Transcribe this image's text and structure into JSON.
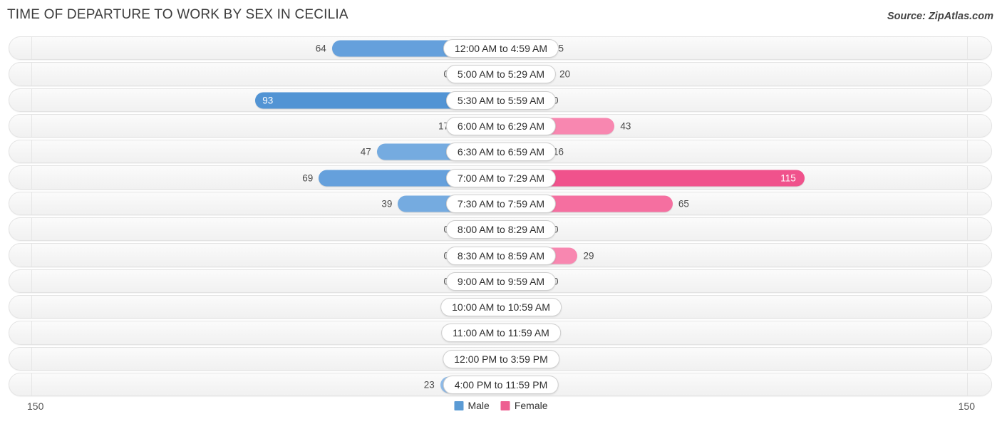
{
  "header": {
    "title": "TIME OF DEPARTURE TO WORK BY SEX IN CECILIA",
    "source": "Source: ZipAtlas.com"
  },
  "legend": {
    "male_label": "Male",
    "female_label": "Female",
    "male_color": "#5b9bd5",
    "female_color": "#ed5f91"
  },
  "axis": {
    "left_max": "150",
    "right_max": "150"
  },
  "chart_data": {
    "type": "bar",
    "title": "TIME OF DEPARTURE TO WORK BY SEX IN CECILIA",
    "orientation": "horizontal-diverging",
    "xlabel": "",
    "ylabel": "",
    "xlim": [
      150,
      150
    ],
    "grid": false,
    "legend_position": "bottom-center",
    "categories": [
      "12:00 AM to 4:59 AM",
      "5:00 AM to 5:29 AM",
      "5:30 AM to 5:59 AM",
      "6:00 AM to 6:29 AM",
      "6:30 AM to 6:59 AM",
      "7:00 AM to 7:29 AM",
      "7:30 AM to 7:59 AM",
      "8:00 AM to 8:29 AM",
      "8:30 AM to 8:59 AM",
      "9:00 AM to 9:59 AM",
      "10:00 AM to 10:59 AM",
      "11:00 AM to 11:59 AM",
      "12:00 PM to 3:59 PM",
      "4:00 PM to 11:59 PM"
    ],
    "series": [
      {
        "name": "Male",
        "values": [
          64,
          0,
          93,
          17,
          47,
          69,
          39,
          0,
          0,
          0,
          0,
          0,
          0,
          23
        ]
      },
      {
        "name": "Female",
        "values": [
          15,
          20,
          0,
          43,
          16,
          115,
          65,
          0,
          29,
          0,
          0,
          0,
          0,
          0
        ]
      }
    ]
  },
  "rows": [
    {
      "label": "12:00 AM to 4:59 AM",
      "male": "64",
      "female": "15"
    },
    {
      "label": "5:00 AM to 5:29 AM",
      "male": "0",
      "female": "20"
    },
    {
      "label": "5:30 AM to 5:59 AM",
      "male": "93",
      "female": "0"
    },
    {
      "label": "6:00 AM to 6:29 AM",
      "male": "17",
      "female": "43"
    },
    {
      "label": "6:30 AM to 6:59 AM",
      "male": "47",
      "female": "16"
    },
    {
      "label": "7:00 AM to 7:29 AM",
      "male": "69",
      "female": "115"
    },
    {
      "label": "7:30 AM to 7:59 AM",
      "male": "39",
      "female": "65"
    },
    {
      "label": "8:00 AM to 8:29 AM",
      "male": "0",
      "female": "0"
    },
    {
      "label": "8:30 AM to 8:59 AM",
      "male": "0",
      "female": "29"
    },
    {
      "label": "9:00 AM to 9:59 AM",
      "male": "0",
      "female": "0"
    },
    {
      "label": "10:00 AM to 10:59 AM",
      "male": "0",
      "female": "0"
    },
    {
      "label": "11:00 AM to 11:59 AM",
      "male": "0",
      "female": "0"
    },
    {
      "label": "12:00 PM to 3:59 PM",
      "male": "0",
      "female": "0"
    },
    {
      "label": "4:00 PM to 11:59 PM",
      "male": "23",
      "female": "0"
    }
  ]
}
